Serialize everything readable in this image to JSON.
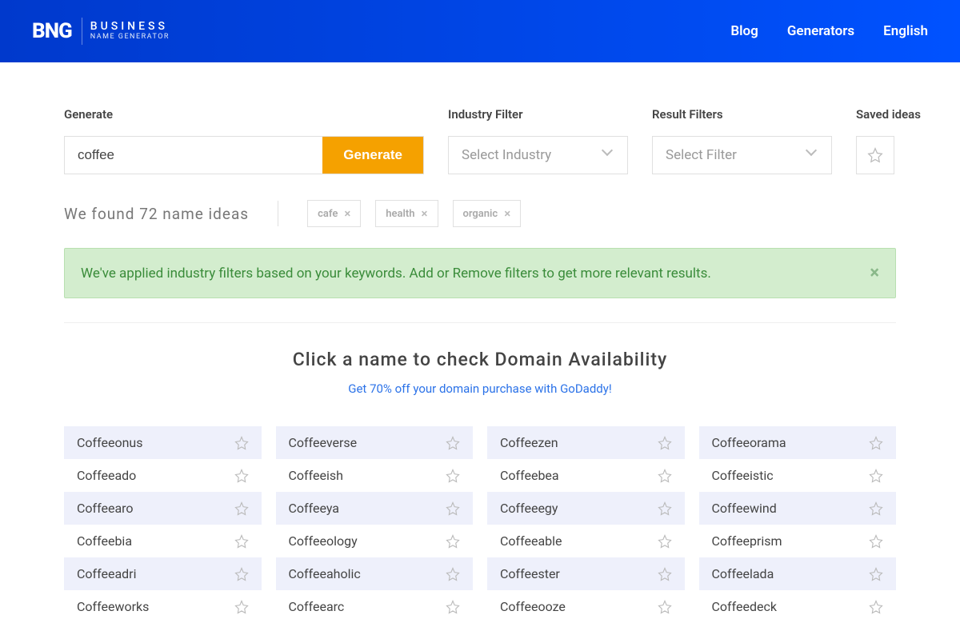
{
  "header": {
    "logo_mark": "BNG",
    "logo_line1": "BUSINESS",
    "logo_line2": "NAME GENERATOR",
    "nav": {
      "blog": "Blog",
      "generators": "Generators",
      "language": "English"
    }
  },
  "controls": {
    "generate_label": "Generate",
    "generate_value": "coffee",
    "generate_button": "Generate",
    "industry_label": "Industry Filter",
    "industry_placeholder": "Select Industry",
    "result_label": "Result Filters",
    "result_placeholder": "Select Filter",
    "saved_label": "Saved ideas"
  },
  "results_count": "We found 72 name ideas",
  "chips": [
    "cafe",
    "health",
    "organic"
  ],
  "alert": "We've applied industry filters based on your keywords. Add or Remove filters to get more relevant results.",
  "domain": {
    "title": "Click a name to check Domain Availability",
    "sub": "Get 70% off your domain purchase with GoDaddy!"
  },
  "names": [
    [
      "Coffeeonus",
      "Coffeeverse",
      "Coffeezen",
      "Coffeeorama"
    ],
    [
      "Coffeeado",
      "Coffeeish",
      "Coffeebea",
      "Coffeeistic"
    ],
    [
      "Coffeearo",
      "Coffeeya",
      "Coffeeegy",
      "Coffeewind"
    ],
    [
      "Coffeebia",
      "Coffeeology",
      "Coffeeable",
      "Coffeeprism"
    ],
    [
      "Coffeeadri",
      "Coffeeaholic",
      "Coffeester",
      "Coffeelada"
    ],
    [
      "Coffeeworks",
      "Coffeearc",
      "Coffeeooze",
      "Coffeedeck"
    ]
  ]
}
